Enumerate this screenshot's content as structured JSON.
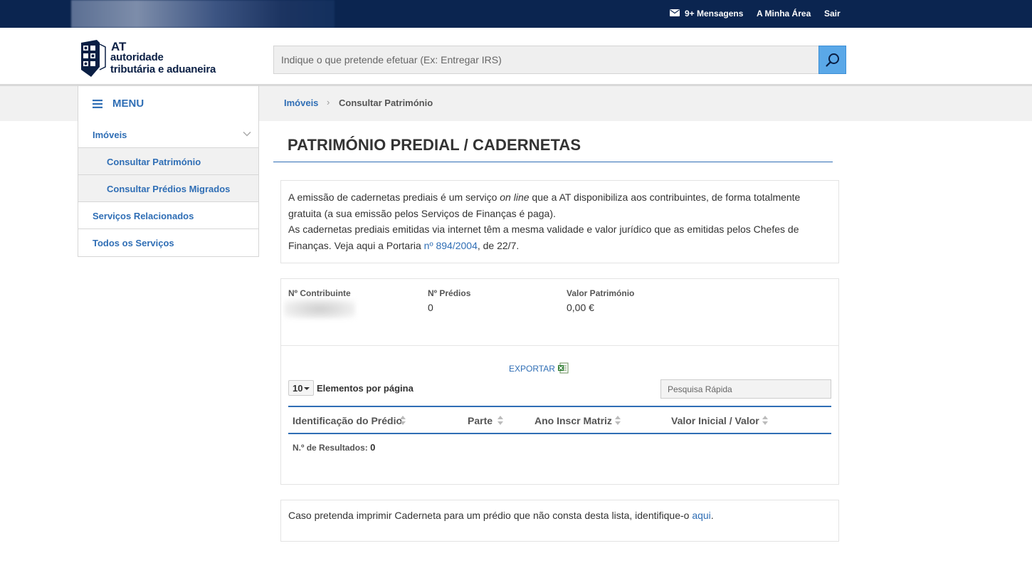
{
  "topbar": {
    "messages": "9+ Mensagens",
    "my_area": "A Minha Área",
    "logout": "Sair"
  },
  "logo": {
    "short": "AT",
    "line1": "autoridade",
    "line2": "tributária e aduaneira"
  },
  "search": {
    "placeholder": "Indique o que pretende efetuar (Ex: Entregar IRS)"
  },
  "menu": {
    "label": "MENU"
  },
  "breadcrumb": {
    "parent": "Imóveis",
    "separator": "›",
    "current": "Consultar Património"
  },
  "sidebar": {
    "items": [
      {
        "label": "Imóveis"
      },
      {
        "label": "Consultar Património"
      },
      {
        "label": "Consultar Prédios Migrados"
      },
      {
        "label": "Serviços Relacionados"
      },
      {
        "label": "Todos os Serviços"
      }
    ]
  },
  "page": {
    "title": "PATRIMÓNIO PREDIAL / CADERNETAS"
  },
  "intro": {
    "p1_a": "A emissão de cadernetas prediais é um serviço ",
    "p1_em": "on line",
    "p1_b": " que a AT disponibiliza aos contribuintes, de forma totalmente gratuita (a sua emissão pelos Serviços de Finanças é paga).",
    "p2_a": "As cadernetas prediais emitidas via internet têm a mesma validade e valor jurídico que as emitidas pelos Chefes de Finanças. Veja aqui a Portaria ",
    "p2_link": "nº 894/2004",
    "p2_b": ", de 22/7."
  },
  "stats": {
    "taxpayer_label": "Nº Contribuinte",
    "buildings_label": "Nº Prédios",
    "buildings_value": "0",
    "value_label": "Valor Património",
    "value_value": "0,00 €"
  },
  "table": {
    "export_label": "EXPORTAR",
    "page_size": "10",
    "page_size_label": "Elementos por página",
    "quick_search_placeholder": "Pesquisa Rápida",
    "columns": [
      "Identificação do Prédio",
      "Parte",
      "Ano Inscr Matriz",
      "Valor Inicial / Valor"
    ],
    "results_label": "N.º de Resultados:",
    "results_count": "0"
  },
  "note": {
    "text": "Caso pretenda imprimir Caderneta para um prédio que não consta desta lista, identifique-o ",
    "link": "aqui",
    "end": "."
  },
  "colors": {
    "topbar": "#0b2550",
    "accent": "#2f6eb5",
    "search_button": "#5aa8e8"
  }
}
